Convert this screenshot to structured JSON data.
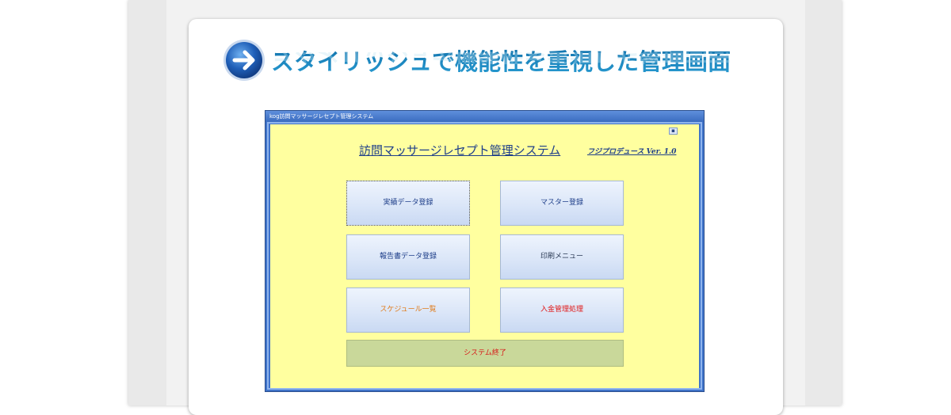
{
  "page": {
    "heading": "スタイリッシュで機能性を重視した管理画面"
  },
  "app_window": {
    "title_bar": "kog訪問マッサージレセプト管理システム",
    "app_title": "訪問マッサージレセプト管理システム",
    "producer": "フジプロデュース Ver. 1.0",
    "buttons": {
      "jisseki": "実績データ登録",
      "master": "マスター登録",
      "houkoku": "報告書データ登録",
      "insatsu": "印刷メニュー",
      "schedule": "スケジュール一覧",
      "nyukin": "入金管理処理",
      "exit": "システム終了"
    }
  },
  "colors": {
    "heading": "#1a7fbf",
    "window_frame": "#3f73c9",
    "client_bg": "#ffff9f",
    "exit_bg": "#c9d89a",
    "orange_text": "#e07b1a",
    "red_text": "#e01818"
  },
  "icons": {
    "heading": "arrow-right-circle-icon",
    "window_control": "minimize-icon"
  }
}
